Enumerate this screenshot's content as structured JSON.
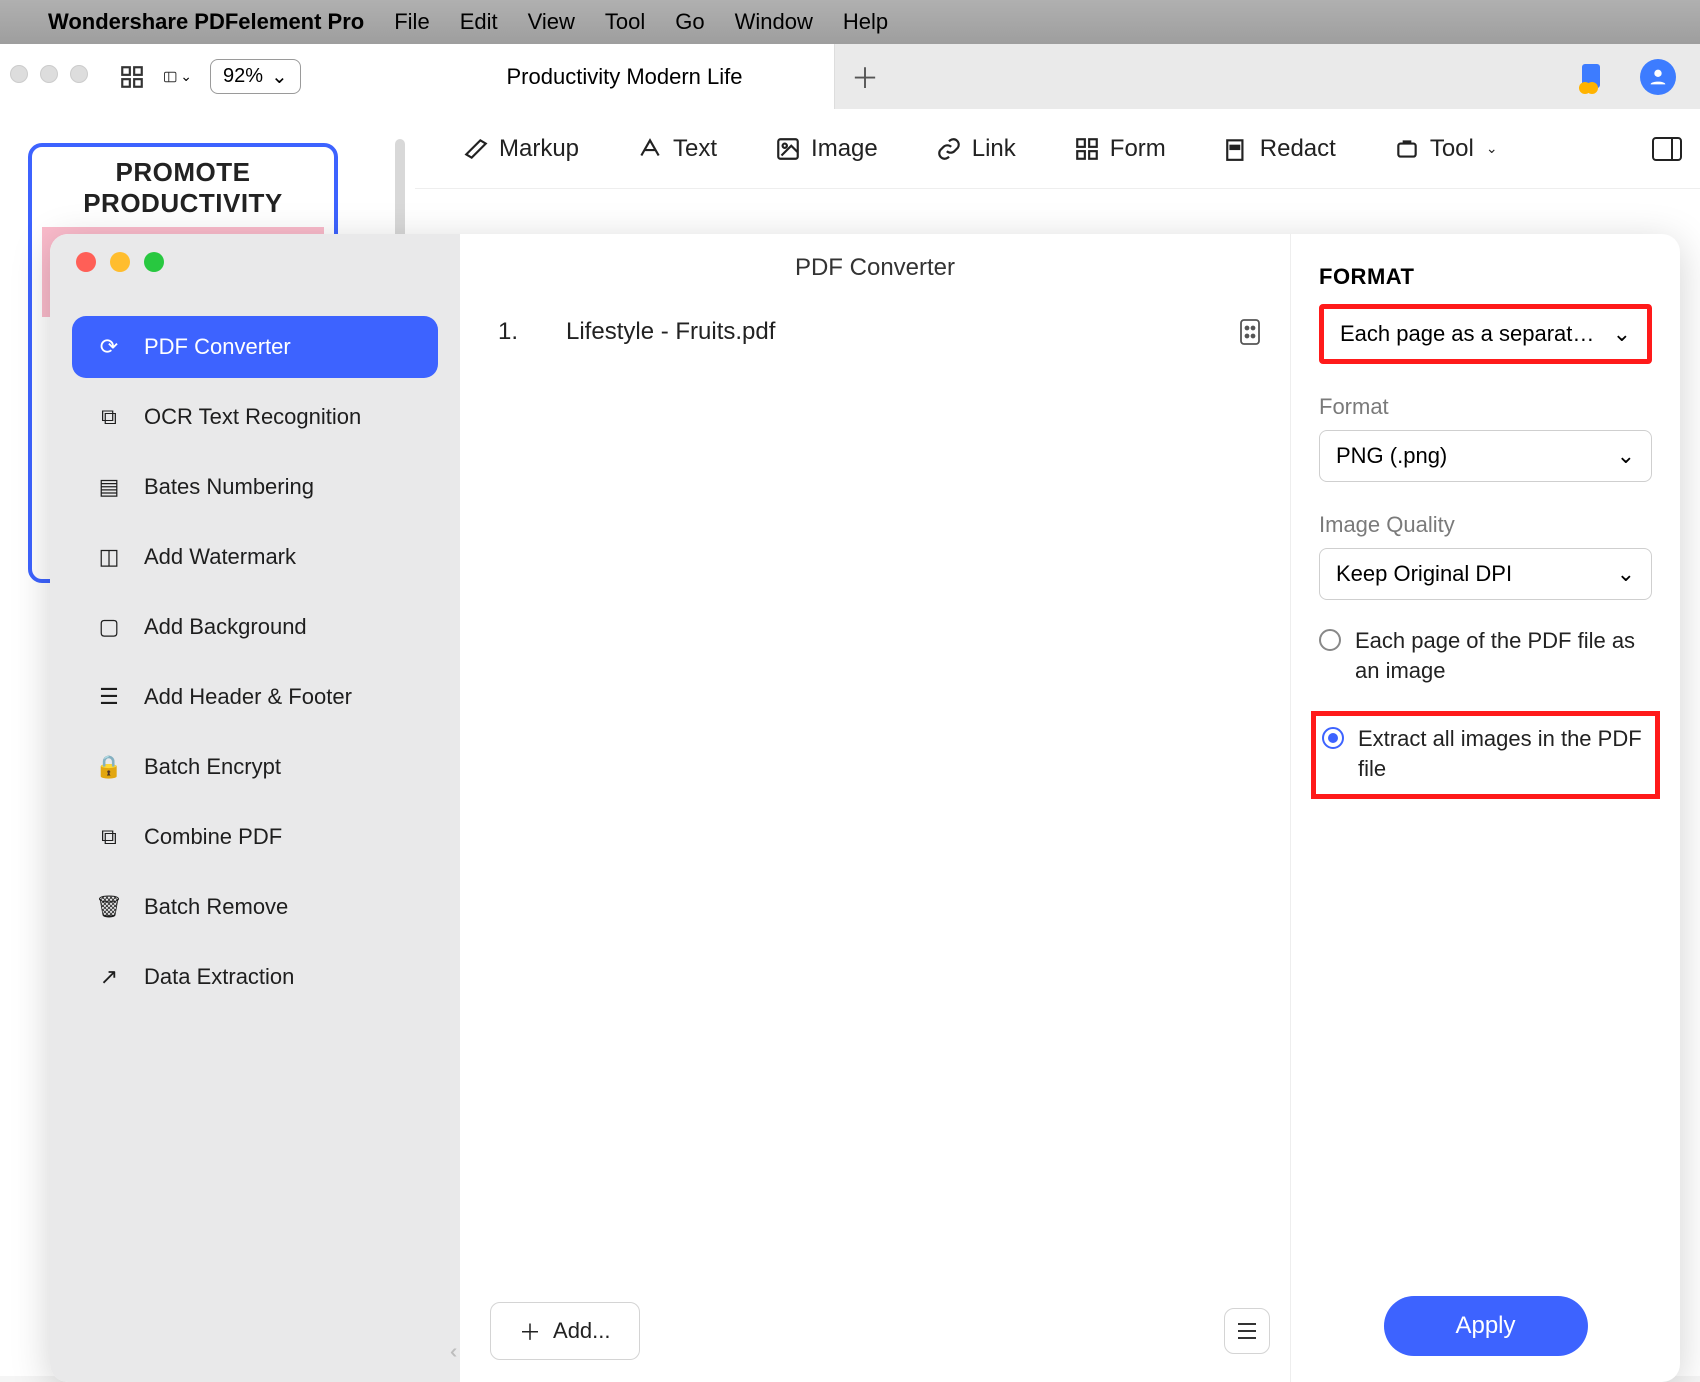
{
  "menubar": {
    "app_name": "Wondershare PDFelement Pro",
    "items": [
      "File",
      "Edit",
      "View",
      "Tool",
      "Go",
      "Window",
      "Help"
    ]
  },
  "toolbar": {
    "zoom": "92%"
  },
  "tabs": {
    "active": "Productivity Modern Life"
  },
  "ribbon": {
    "items": [
      "Markup",
      "Text",
      "Image",
      "Link",
      "Form",
      "Redact",
      "Tool"
    ]
  },
  "thumbnail": {
    "banner": "PROMOTE PRODUCTIVITY"
  },
  "modal": {
    "title": "PDF Converter",
    "sidebar": [
      "PDF Converter",
      "OCR Text Recognition",
      "Bates Numbering",
      "Add Watermark",
      "Add Background",
      "Add Header & Footer",
      "Batch Encrypt",
      "Combine PDF",
      "Batch Remove",
      "Data Extraction"
    ],
    "file": {
      "index": "1.",
      "name": "Lifestyle - Fruits.pdf"
    },
    "add_label": "Add...",
    "format_heading": "FORMAT",
    "page_mode": "Each page as a separat…",
    "format_label": "Format",
    "format_value": "PNG (.png)",
    "quality_label": "Image Quality",
    "quality_value": "Keep Original DPI",
    "radio_each_page": "Each page of the PDF file as an image",
    "radio_extract": "Extract all images in the PDF file",
    "apply": "Apply"
  }
}
